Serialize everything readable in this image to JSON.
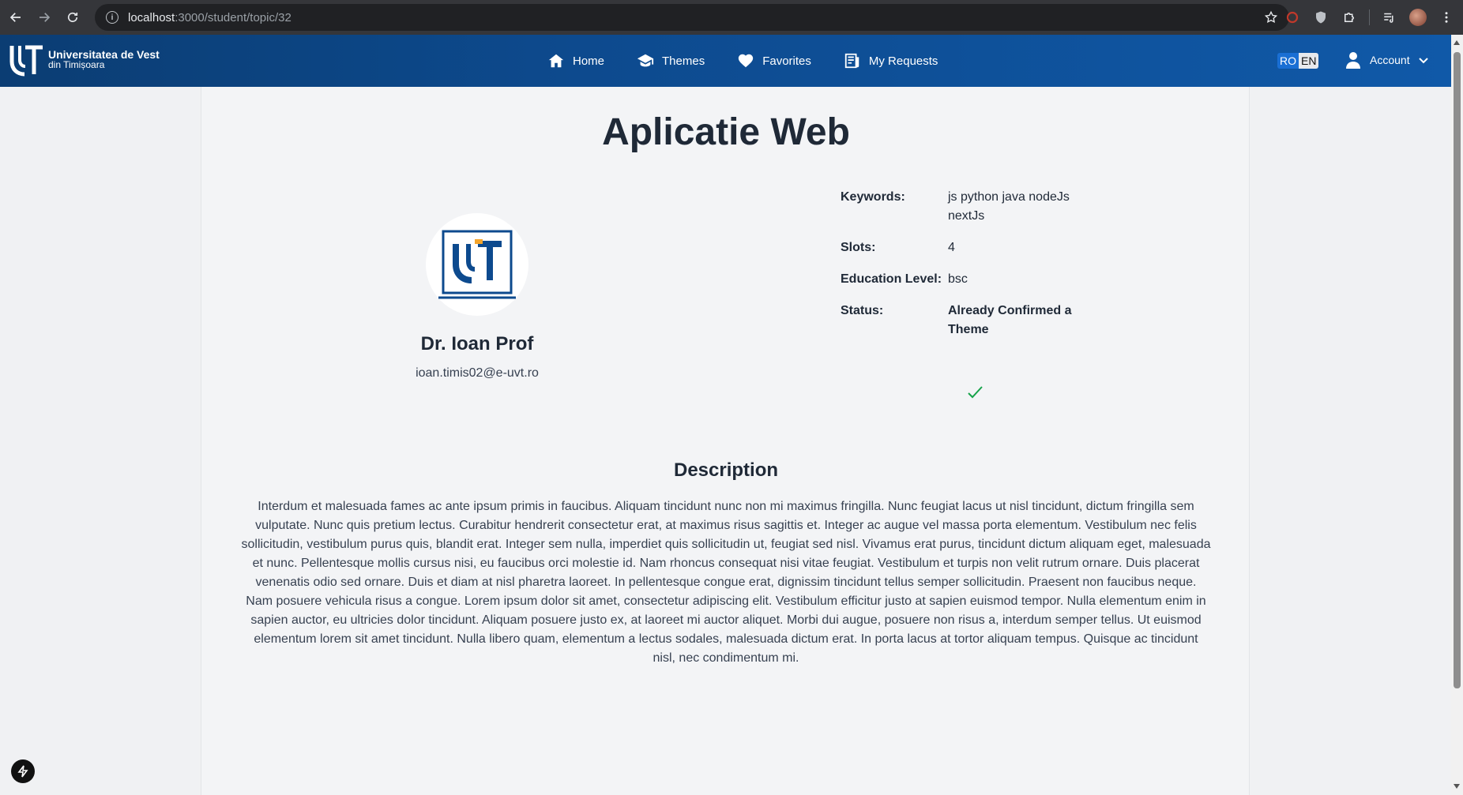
{
  "browser": {
    "url_host": "localhost",
    "url_path": ":3000/student/topic/32"
  },
  "navbar": {
    "logo_line1": "Universitatea de Vest",
    "logo_line2": "din Timișoara",
    "items": [
      {
        "label": "Home",
        "icon": "home-icon"
      },
      {
        "label": "Themes",
        "icon": "graduation-cap-icon"
      },
      {
        "label": "Favorites",
        "icon": "heart-icon"
      },
      {
        "label": "My Requests",
        "icon": "document-icon"
      }
    ],
    "lang_ro": "RO",
    "lang_en": "EN",
    "account_label": "Account"
  },
  "topic": {
    "title": "Aplicatie Web",
    "professor_name": "Dr. Ioan Prof",
    "professor_email": "ioan.timis02@e-uvt.ro",
    "details": [
      {
        "key": "Keywords:",
        "value": "js python java nodeJs nextJs"
      },
      {
        "key": "Slots:",
        "value": "4"
      },
      {
        "key": "Education Level:",
        "value": "bsc"
      },
      {
        "key": "Status:",
        "value": "Already Confirmed a Theme"
      }
    ],
    "description_title": "Description",
    "description": "Interdum et malesuada fames ac ante ipsum primis in faucibus. Aliquam tincidunt nunc non mi maximus fringilla. Nunc feugiat lacus ut nisl tincidunt, dictum fringilla sem vulputate. Nunc quis pretium lectus. Curabitur hendrerit consectetur erat, at maximus risus sagittis et. Integer ac augue vel massa porta elementum. Vestibulum nec felis sollicitudin, vestibulum purus quis, blandit erat. Integer sem nulla, imperdiet quis sollicitudin ut, feugiat sed nisl. Vivamus erat purus, tincidunt dictum aliquam eget, malesuada et nunc. Pellentesque mollis cursus nisi, eu faucibus orci molestie id. Nam rhoncus consequat nisi vitae feugiat. Vestibulum et turpis non velit rutrum ornare. Duis placerat venenatis odio sed ornare. Duis et diam at nisl pharetra laoreet. In pellentesque congue erat, dignissim tincidunt tellus semper sollicitudin. Praesent non faucibus neque. Nam posuere vehicula risus a congue. Lorem ipsum dolor sit amet, consectetur adipiscing elit. Vestibulum efficitur justo at sapien euismod tempor. Nulla elementum enim in sapien auctor, eu ultricies dolor tincidunt. Aliquam posuere justo ex, at laoreet mi auctor aliquet. Morbi dui augue, posuere non risus a, interdum semper tellus. Ut euismod elementum lorem sit amet tincidunt. Nulla libero quam, elementum a lectus sodales, malesuada dictum erat. In porta lacus at tortor aliquam tempus. Quisque ac tincidunt nisl, nec condimentum mi."
  },
  "colors": {
    "navbar": "#0d4a8e",
    "accent": "#1a6fd4",
    "check": "#16a34a"
  }
}
